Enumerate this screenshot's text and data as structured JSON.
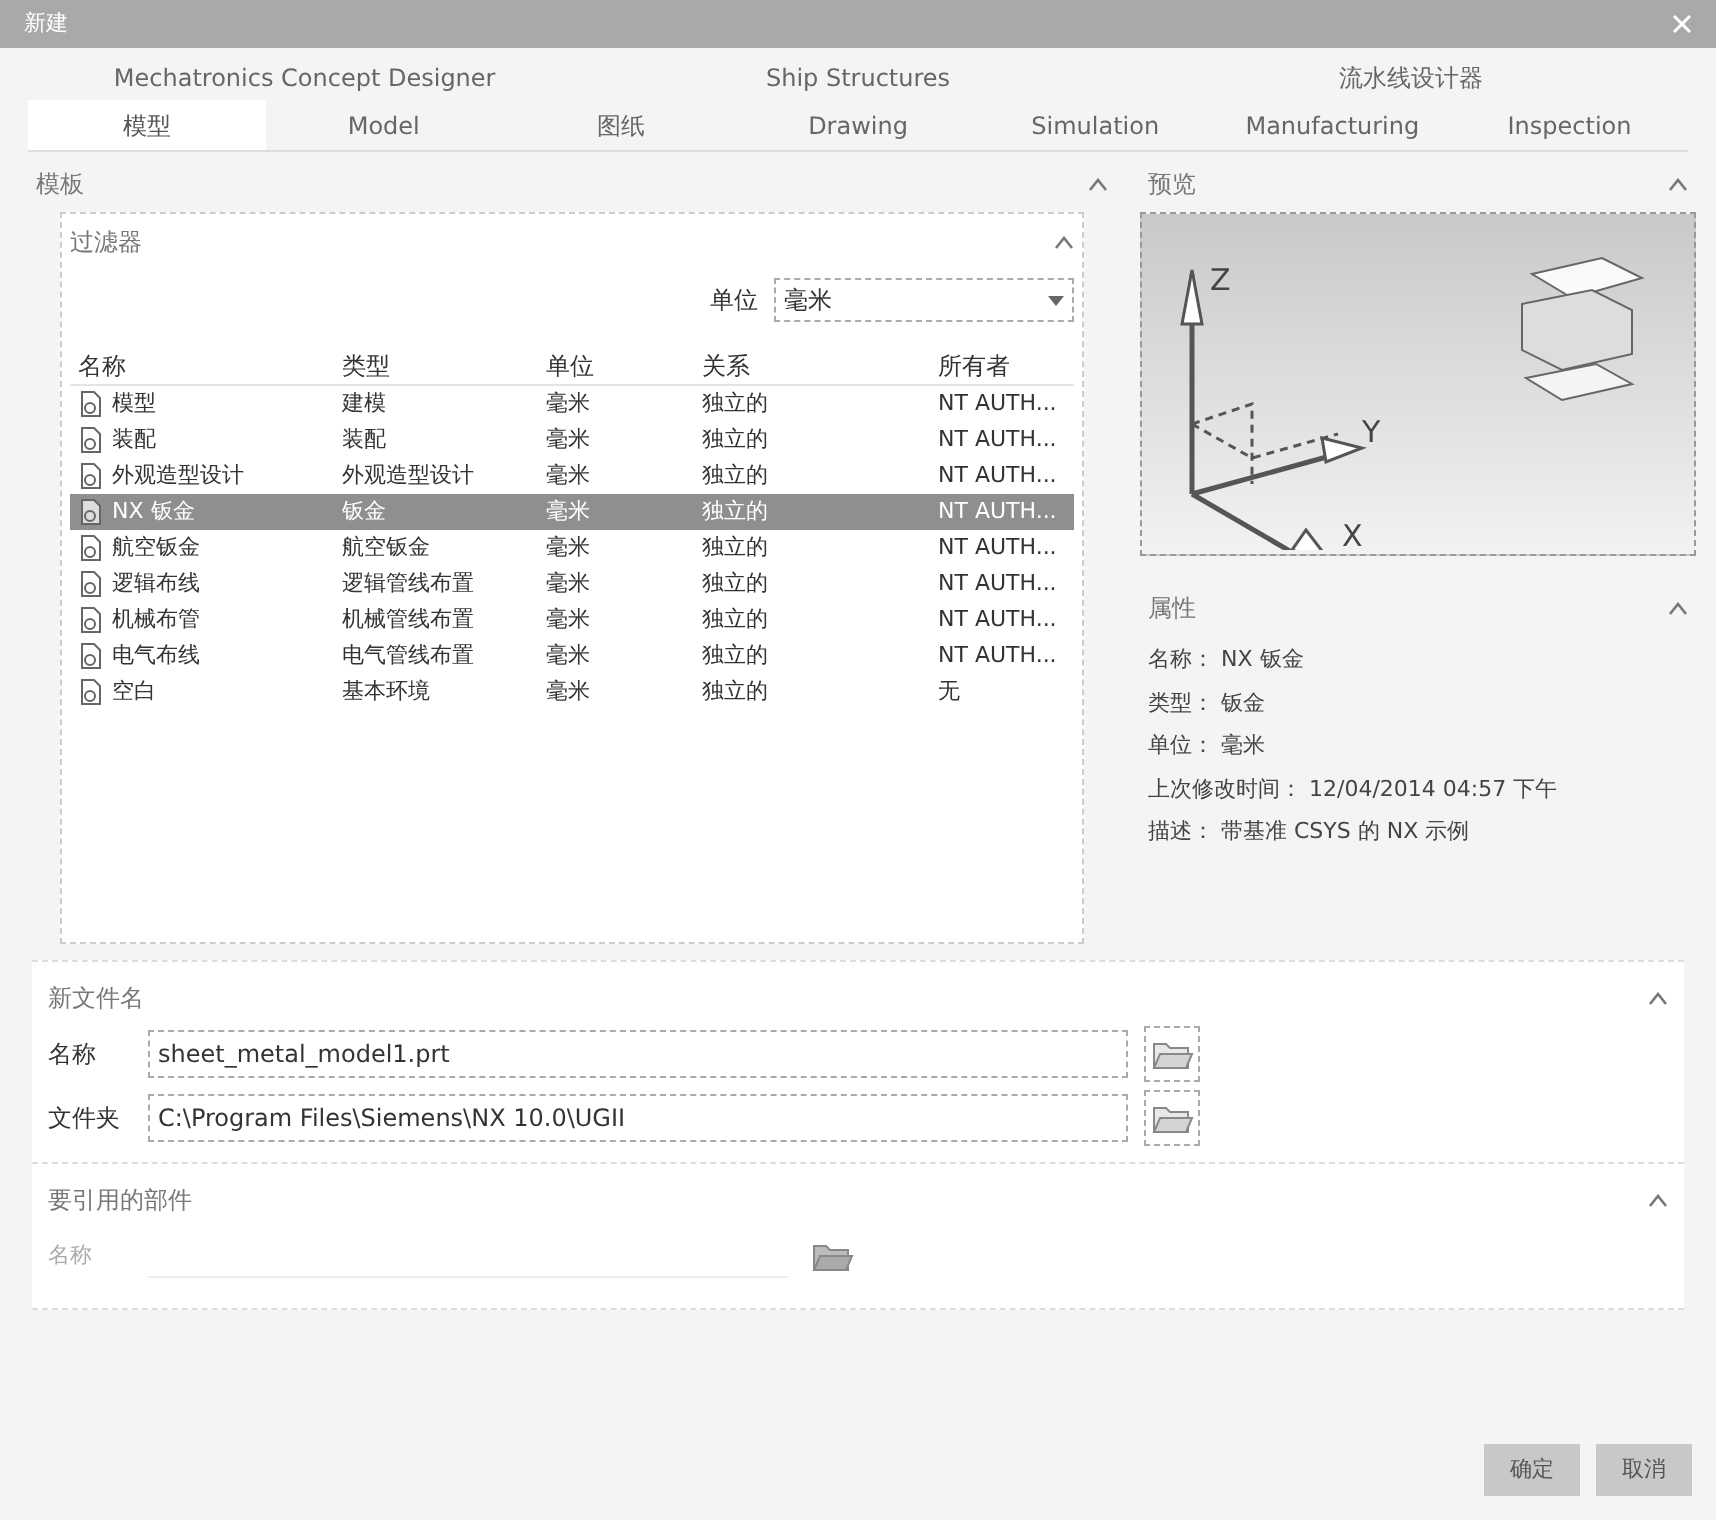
{
  "window": {
    "title": "新建"
  },
  "tab_rows": [
    [
      {
        "label": "Mechatronics Concept Designer",
        "selected": false
      },
      {
        "label": "Ship Structures",
        "selected": false
      },
      {
        "label": "流水线设计器",
        "selected": false
      }
    ],
    [
      {
        "label": "模型",
        "selected": true
      },
      {
        "label": "Model",
        "selected": false
      },
      {
        "label": "图纸",
        "selected": false
      },
      {
        "label": "Drawing",
        "selected": false
      },
      {
        "label": "Simulation",
        "selected": false
      },
      {
        "label": "Manufacturing",
        "selected": false
      },
      {
        "label": "Inspection",
        "selected": false
      }
    ]
  ],
  "templates": {
    "title": "模板",
    "filter": {
      "title": "过滤器",
      "unit_label": "单位",
      "unit_value": "毫米"
    },
    "columns": [
      "名称",
      "类型",
      "单位",
      "关系",
      "所有者"
    ],
    "rows": [
      {
        "cells": [
          "模型",
          "建模",
          "毫米",
          "独立的",
          "NT AUTH..."
        ],
        "selected": false
      },
      {
        "cells": [
          "装配",
          "装配",
          "毫米",
          "独立的",
          "NT AUTH..."
        ],
        "selected": false
      },
      {
        "cells": [
          "外观造型设计",
          "外观造型设计",
          "毫米",
          "独立的",
          "NT AUTH..."
        ],
        "selected": false
      },
      {
        "cells": [
          "NX 钣金",
          "钣金",
          "毫米",
          "独立的",
          "NT AUTH..."
        ],
        "selected": true
      },
      {
        "cells": [
          "航空钣金",
          "航空钣金",
          "毫米",
          "独立的",
          "NT AUTH..."
        ],
        "selected": false
      },
      {
        "cells": [
          "逻辑布线",
          "逻辑管线布置",
          "毫米",
          "独立的",
          "NT AUTH..."
        ],
        "selected": false
      },
      {
        "cells": [
          "机械布管",
          "机械管线布置",
          "毫米",
          "独立的",
          "NT AUTH..."
        ],
        "selected": false
      },
      {
        "cells": [
          "电气布线",
          "电气管线布置",
          "毫米",
          "独立的",
          "NT AUTH..."
        ],
        "selected": false
      },
      {
        "cells": [
          "空白",
          "基本环境",
          "毫米",
          "独立的",
          "无"
        ],
        "selected": false
      }
    ]
  },
  "preview": {
    "title": "预览",
    "axis_labels": [
      "Z",
      "Y",
      "X"
    ]
  },
  "properties": {
    "title": "属性",
    "lines": [
      "名称： NX 钣金",
      "类型： 钣金",
      "单位： 毫米",
      "上次修改时间： 12/04/2014 04:57 下午",
      "描述： 带基准 CSYS 的 NX 示例"
    ]
  },
  "new_file": {
    "title": "新文件名",
    "fields": [
      {
        "label": "名称",
        "value": "sheet_metal_model1.prt"
      },
      {
        "label": "文件夹",
        "value": "C:\\Program Files\\Siemens\\NX 10.0\\UGII"
      }
    ]
  },
  "referenced_parts": {
    "title": "要引用的部件",
    "fields": [
      {
        "label": "名称",
        "disabled": true
      }
    ]
  },
  "buttons": [
    "确定",
    "取消"
  ]
}
